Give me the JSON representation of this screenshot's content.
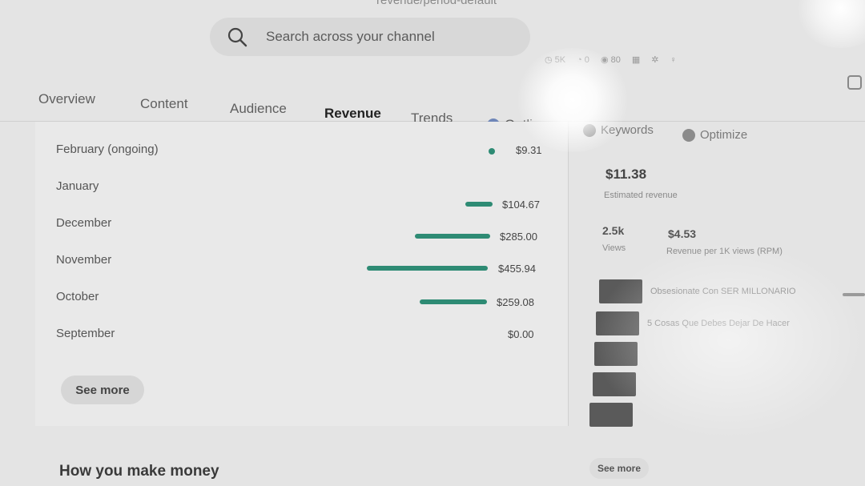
{
  "url_fragment": "revenue/period-default",
  "search": {
    "placeholder": "Search across your channel"
  },
  "header_icons": [
    "history-icon",
    "notification-icon",
    "views-icon",
    "grid-icon",
    "settings-icon",
    "help-icon"
  ],
  "tabs": [
    {
      "label": "Overview",
      "active": false
    },
    {
      "label": "Content",
      "active": false
    },
    {
      "label": "Audience",
      "active": false
    },
    {
      "label": "Revenue",
      "active": true
    },
    {
      "label": "Trends",
      "active": false
    },
    {
      "label": "Outliers",
      "active": false,
      "icon": "outliers-icon"
    },
    {
      "label": "Keywords",
      "active": false,
      "icon": "keywords-icon"
    },
    {
      "label": "Optimize",
      "active": false,
      "icon": "optimize-icon"
    }
  ],
  "monthly_revenue": {
    "accent_color": "#2e8b74",
    "rows": [
      {
        "month": "February (ongoing)",
        "value": "$9.31",
        "amount": 9.31
      },
      {
        "month": "January",
        "value": "$104.67",
        "amount": 104.67
      },
      {
        "month": "December",
        "value": "$285.00",
        "amount": 285.0
      },
      {
        "month": "November",
        "value": "$455.94",
        "amount": 455.94
      },
      {
        "month": "October",
        "value": "$259.08",
        "amount": 259.08
      },
      {
        "month": "September",
        "value": "$0.00",
        "amount": 0
      }
    ],
    "see_more_label": "See more"
  },
  "summary": {
    "estimated_revenue": "$11.38",
    "estimated_revenue_label": "Estimated revenue",
    "views_value": "2.5k",
    "views_label": "Views",
    "rpm_value": "$4.53",
    "rpm_label": "Revenue per 1K views (RPM)",
    "top_videos": [
      {
        "title": "Obsesionate Con SER MILLONARIO"
      },
      {
        "title": "5 Cosas Que Debes Dejar De Hacer"
      },
      {
        "title": ""
      },
      {
        "title": ""
      },
      {
        "title": ""
      }
    ],
    "see_more_label": "See more"
  },
  "section_title": "How you make money"
}
